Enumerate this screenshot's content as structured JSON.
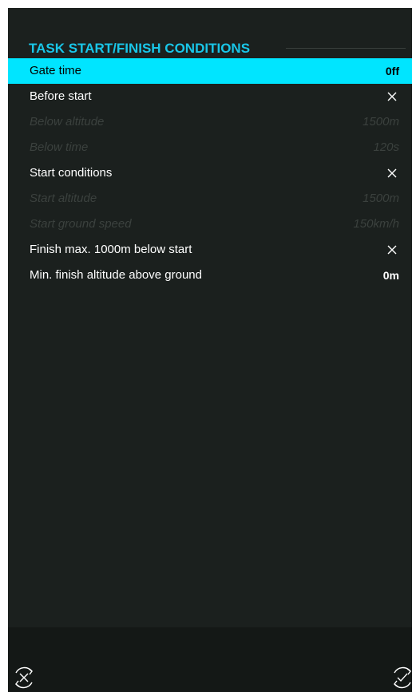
{
  "section": {
    "title": "TASK START/FINISH CONDITIONS"
  },
  "rows": [
    {
      "label": "Gate time",
      "value": "0ff",
      "state": "selected",
      "kind": "text"
    },
    {
      "label": "Before start",
      "value": "",
      "state": "enabled",
      "kind": "toggle-off",
      "icon": "x-mark-icon"
    },
    {
      "label": "Below altitude",
      "value": "1500m",
      "state": "disabled",
      "kind": "text"
    },
    {
      "label": "Below time",
      "value": "120s",
      "state": "disabled",
      "kind": "text"
    },
    {
      "label": "Start conditions",
      "value": "",
      "state": "enabled",
      "kind": "toggle-off",
      "icon": "x-mark-icon"
    },
    {
      "label": "Start altitude",
      "value": "1500m",
      "state": "disabled",
      "kind": "text"
    },
    {
      "label": "Start ground speed",
      "value": "150km/h",
      "state": "disabled",
      "kind": "text"
    },
    {
      "label": "Finish max. 1000m below start",
      "value": "",
      "state": "enabled",
      "kind": "toggle-off",
      "icon": "x-mark-icon"
    },
    {
      "label": "Min. finish altitude above ground",
      "value": "0m",
      "state": "enabled",
      "kind": "text"
    }
  ],
  "footer": {
    "cancel_icon": "rotate-cancel-icon",
    "confirm_icon": "rotate-confirm-icon"
  },
  "colors": {
    "accent": "#19c6e8",
    "selected_bg": "#00e5ff",
    "background": "#1b201e",
    "disabled_text": "#3b413e"
  }
}
